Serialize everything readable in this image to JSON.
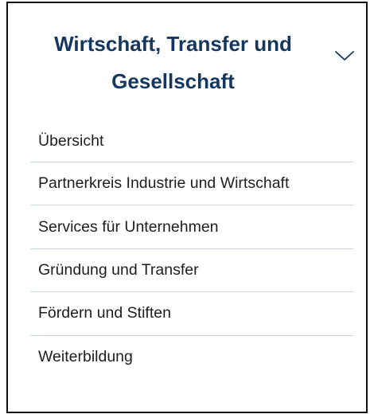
{
  "section": {
    "title_line1": "Wirtschaft, Transfer und",
    "title_line2": "Gesellschaft",
    "toggle_icon": "chevron-down-icon",
    "title_color": "#14365f"
  },
  "menu": {
    "items": [
      {
        "label": "Übersicht"
      },
      {
        "label": "Partnerkreis Industrie und Wirtschaft"
      },
      {
        "label": "Services für Unternehmen"
      },
      {
        "label": "Gründung und Transfer"
      },
      {
        "label": "Fördern und Stiften"
      },
      {
        "label": "Weiterbildung"
      }
    ],
    "divider_color": "#c9d7e0"
  }
}
